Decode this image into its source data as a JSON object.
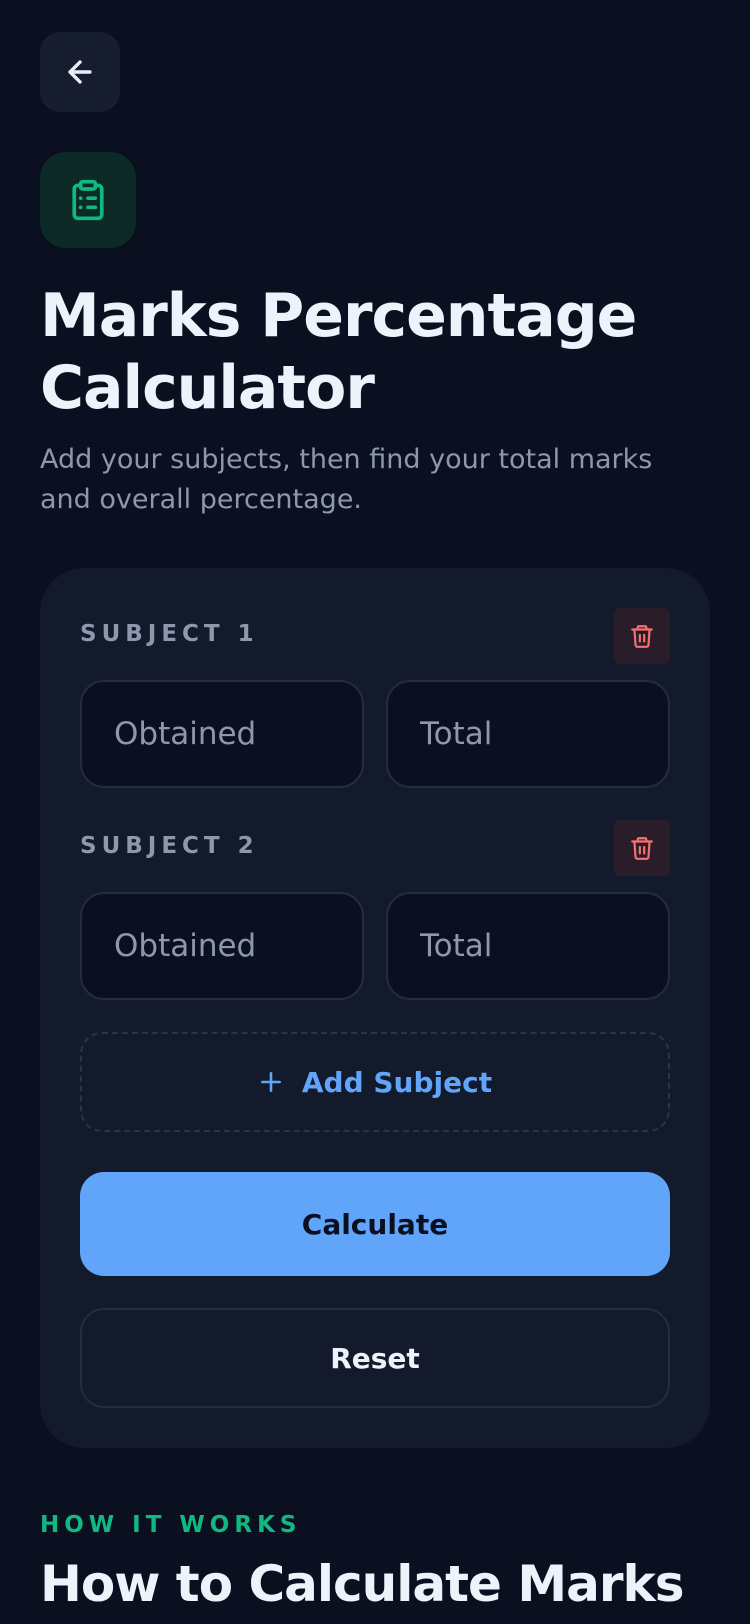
{
  "header": {
    "back_icon": "arrow-left-icon",
    "app_icon": "clipboard-list-icon",
    "title": "Marks Percentage Calculator",
    "subtitle": "Add your subjects, then find your total marks and overall percentage."
  },
  "subjects": [
    {
      "label": "SUBJECT 1",
      "obtained_placeholder": "Obtained",
      "obtained_value": "",
      "total_placeholder": "Total",
      "total_value": "",
      "delete_icon": "trash-icon"
    },
    {
      "label": "SUBJECT 2",
      "obtained_placeholder": "Obtained",
      "obtained_value": "",
      "total_placeholder": "Total",
      "total_value": "",
      "delete_icon": "trash-icon"
    }
  ],
  "actions": {
    "add_icon": "plus-icon",
    "add_label": "Add Subject",
    "calculate_label": "Calculate",
    "reset_label": "Reset"
  },
  "how_it_works": {
    "eyebrow": "HOW IT WORKS",
    "title": "How to Calculate Marks"
  },
  "colors": {
    "background": "#0b1020",
    "card": "#121a2b",
    "accent_blue": "#60a5fa",
    "accent_green": "#10b981",
    "danger": "#f87171",
    "muted_text": "#8d98ad"
  }
}
